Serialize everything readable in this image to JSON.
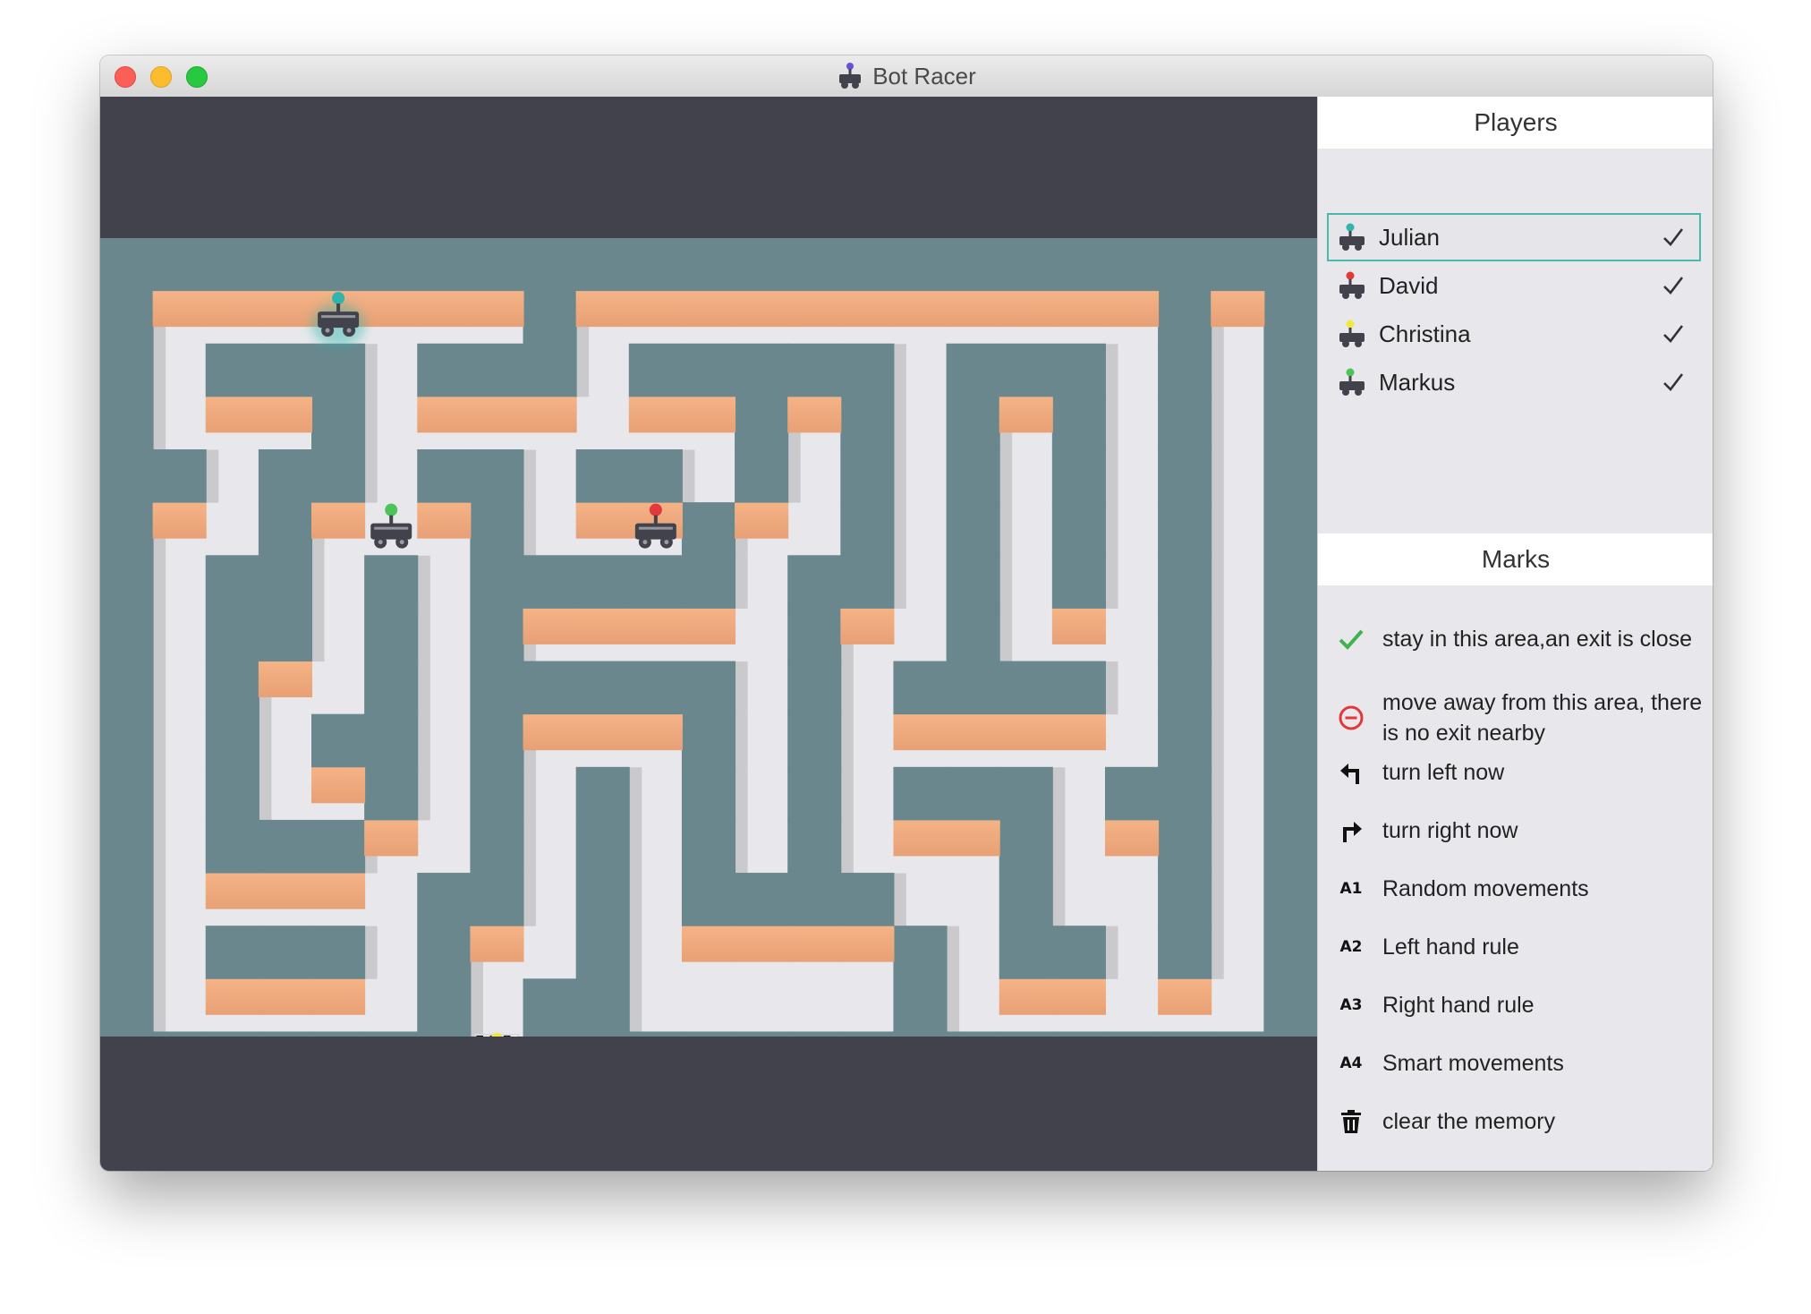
{
  "window": {
    "title": "Bot Racer"
  },
  "players": {
    "title": "Players",
    "items": [
      {
        "name": "Julian",
        "color": "#2fb5ab",
        "checked": true,
        "selected": true
      },
      {
        "name": "David",
        "color": "#e2383a",
        "checked": true,
        "selected": false
      },
      {
        "name": "Christina",
        "color": "#f2e641",
        "checked": true,
        "selected": false
      },
      {
        "name": "Markus",
        "color": "#4cc45a",
        "checked": true,
        "selected": false
      }
    ]
  },
  "marks": {
    "title": "Marks",
    "items": [
      {
        "icon": "check-green-icon",
        "label": "stay in this area,an exit is close"
      },
      {
        "icon": "no-entry-red-icon",
        "label": "move away from this area, there is no exit nearby"
      },
      {
        "icon": "turn-left-icon",
        "label": "turn left now"
      },
      {
        "icon": "turn-right-icon",
        "label": "turn right now"
      },
      {
        "icon": "code",
        "code": "A1",
        "label": "Random movements"
      },
      {
        "icon": "code",
        "code": "A2",
        "label": "Left hand rule"
      },
      {
        "icon": "code",
        "code": "A3",
        "label": "Right hand rule"
      },
      {
        "icon": "code",
        "code": "A4",
        "label": "Smart movements"
      },
      {
        "icon": "trash-icon",
        "label": "clear the memory"
      }
    ]
  },
  "colors": {
    "wall": "#6a878e",
    "wall_face": "#f2ad7e",
    "floor": "#e8e8ec",
    "background": "#42424c",
    "mark_highlight": "#8ecfca"
  },
  "maze": {
    "cols": 23,
    "rows": 16,
    "grid": [
      "#######################",
      "#.......#...........#.#",
      "#.###.###.#####.###.#.#",
      "#...#.......#.#.#.#.#.#",
      "##.##.##.##.#.#.#.#.#.#",
      "#..#...#...#..#.#.#.#.#",
      "#.##.#.#####.##.#.#.#.#",
      "#.##.#.#.....#..#...#.#",
      "#.#..#.#####.#.####.#.#",
      "#.#.##.#...#.#......#.#",
      "#.#..#.#.#.#.#.###.##.#",
      "#.###..#.#.#.#...#..#.#",
      "#.....##.#.####..#..#.#",
      "#.###.#..#.....#.##.#.#",
      "#.....#.##.....#......#",
      "#######.###############"
    ],
    "highlight_cells": [
      {
        "col": 11,
        "row": 11
      }
    ],
    "robots": [
      {
        "player": "Julian",
        "col": 4,
        "row": 1,
        "color": "#2fb5ab",
        "glow": true
      },
      {
        "player": "Markus",
        "col": 5,
        "row": 5,
        "color": "#4cc45a",
        "glow": false
      },
      {
        "player": "David",
        "col": 10,
        "row": 5,
        "color": "#e2383a",
        "glow": false
      },
      {
        "player": "Christina",
        "col": 7,
        "row": 15,
        "color": "#f2e641",
        "glow": false,
        "finish": true
      }
    ]
  }
}
